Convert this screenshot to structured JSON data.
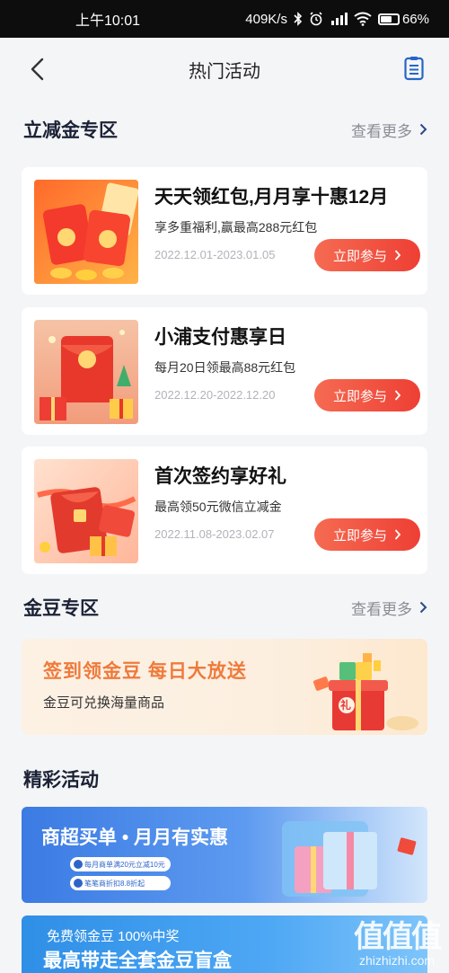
{
  "status": {
    "time": "上午10:01",
    "speed": "409K/s",
    "battery": "66%",
    "battery_level": 0.66
  },
  "nav": {
    "title": "热门活动",
    "back_icon": "chevron-left-icon",
    "list_icon": "clipboard-list-icon"
  },
  "section_cashback": {
    "title": "立减金专区",
    "more": "查看更多"
  },
  "cards": [
    {
      "title": "天天领红包,月月享十惠12月",
      "desc": "享多重福利,赢最高288元红包",
      "date": "2022.12.01-2023.01.05",
      "button": "立即参与"
    },
    {
      "title": "小浦支付惠享日",
      "desc": "每月20日领最高88元红包",
      "date": "2022.12.20-2022.12.20",
      "button": "立即参与"
    },
    {
      "title": "首次签约享好礼",
      "desc": "最高领50元微信立减金",
      "date": "2022.11.08-2023.02.07",
      "button": "立即参与"
    }
  ],
  "section_beans": {
    "title": "金豆专区",
    "more": "查看更多"
  },
  "bean_banner": {
    "title": "签到领金豆  每日大放送",
    "subtitle": "金豆可兑换海量商品",
    "gift_mark": "礼"
  },
  "section_events": {
    "title": "精彩活动"
  },
  "promo1": {
    "headline": "商超买单 • 月月有实惠",
    "line1": "每月商单满20元立减10元",
    "line2": "笔笔商折扣8.8折起"
  },
  "promo2": {
    "line1": "免费领金豆 100%中奖",
    "line2": "最高带走全套金豆盲盒"
  },
  "watermark": {
    "chars": "值值值",
    "site": "zhizhizhi.com"
  },
  "colors": {
    "accent_red": "#ee3f34",
    "bean_orange": "#ef7a3c",
    "promo_blue": "#3b7be3"
  }
}
